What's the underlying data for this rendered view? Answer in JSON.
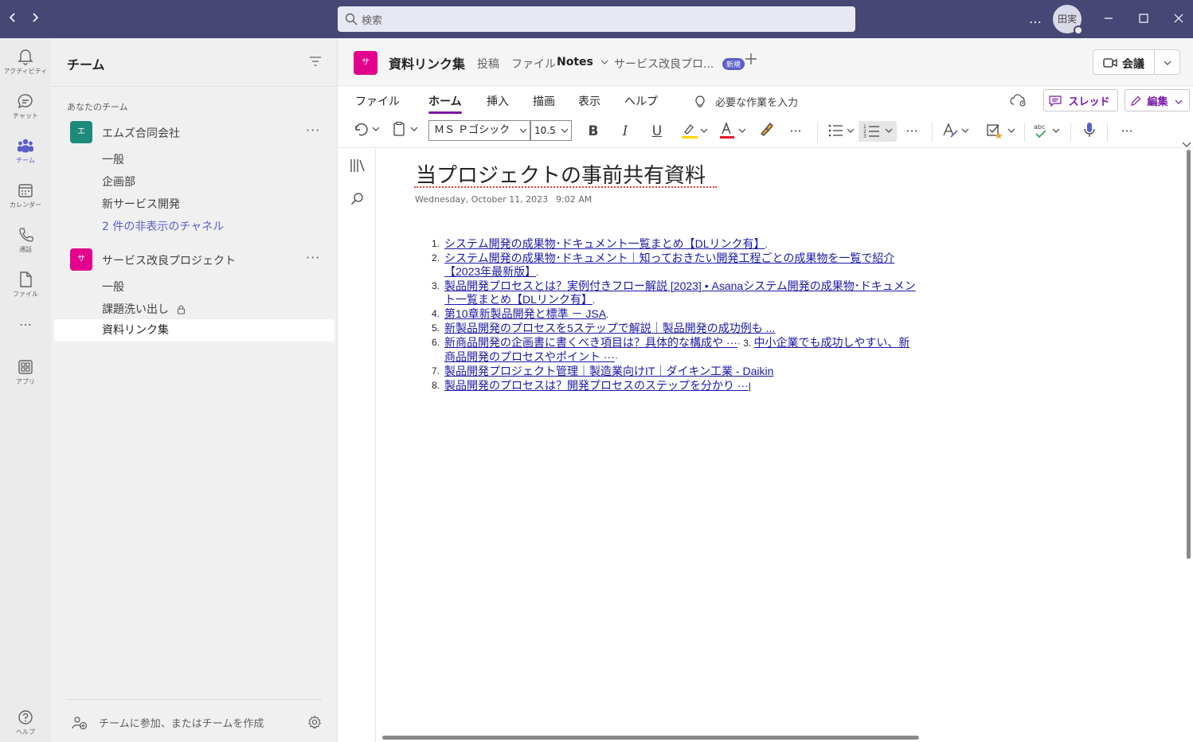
{
  "titlebar": {
    "search_placeholder": "検索",
    "avatar_initials": "田実",
    "more": "…"
  },
  "rail": [
    {
      "name": "activity",
      "label": "アクティビティ"
    },
    {
      "name": "chat",
      "label": "チャット"
    },
    {
      "name": "teams",
      "label": "チーム"
    },
    {
      "name": "calendar",
      "label": "カレンダー"
    },
    {
      "name": "calls",
      "label": "通話"
    },
    {
      "name": "files",
      "label": "ファイル"
    },
    {
      "name": "more",
      "label": "…"
    },
    {
      "name": "apps",
      "label": "アプリ"
    },
    {
      "name": "help",
      "label": "ヘルプ"
    }
  ],
  "teams_panel": {
    "title": "チーム",
    "section": "あなたのチーム",
    "teams": [
      {
        "icon_text": "エ",
        "color": "#1e8a7a",
        "name": "エムズ合同会社",
        "channels": [
          "一般",
          "企画部",
          "新サービス開発"
        ],
        "hidden_channels": "2 件の非表示のチャネル"
      },
      {
        "icon_text": "サ",
        "color": "#e3008c",
        "name": "サービス改良プロジェクト",
        "channels": [
          "一般",
          "課題洗い出し",
          "資料リンク集"
        ]
      }
    ],
    "join": "チームに参加、またはチームを作成"
  },
  "channel_header": {
    "icon_text": "サ",
    "name": "資料リンク集",
    "tabs": [
      "投稿",
      "ファイル",
      "Notes",
      "サービス改良プロ..."
    ],
    "new_badge": "新規",
    "meet_label": "会議"
  },
  "ribbon": {
    "tabs": [
      "ファイル",
      "ホーム",
      "挿入",
      "描画",
      "表示",
      "ヘルプ"
    ],
    "active_tab": "ホーム",
    "tell_me": "必要な作業を入力",
    "thread_button": "スレッド",
    "edit_button": "編集",
    "font_name": "ＭＳ Ｐゴシック",
    "font_size": "10.5",
    "accent_color": "#7719aa"
  },
  "page": {
    "title": "当プロジェクトの事前共有資料",
    "date": "Wednesday, October 11, 2023",
    "time": "9:02 AM",
    "items": [
      {
        "num": "1.",
        "text": "システム開発の成果物･ドキュメント一覧まとめ【DLリンク有】",
        "suffix": "."
      },
      {
        "num": "2.",
        "text": "システム開発の成果物･ドキュメント｜知っておきたい開発工程ごとの成果物を一覧で紹介【2023年最新版】",
        "suffix": "."
      },
      {
        "num": "3.",
        "text": "製品開発プロセスとは？実例付きフロー解説 [2023] • Asanaシステム開発の成果物･ドキュメント一覧まとめ【DLリンク有】",
        "suffix": "."
      },
      {
        "num": "4.",
        "text": "第10章新製品開発と標準 － JSA",
        "suffix": "."
      },
      {
        "num": "5.",
        "text": "新製品開発のプロセスを5ステップで解説｜製品開発の成功例も ...",
        "suffix": ""
      },
      {
        "num": "6.",
        "text": " 新商品開発の企画書に書くべき項目は？具体的な構成や ···",
        "suffix": "· 3.   ",
        "text2": "中小企業でも成功しやすい、新商品開発のプロセスやポイント ···",
        "suffix2": "·"
      },
      {
        "num": "7.",
        "text": "製品開発プロジェクト管理｜製造業向けIT｜ダイキン工業 - Daikin",
        "suffix": ""
      },
      {
        "num": "8.",
        "text": " 製品開発のプロセスは？開発プロセスのステップを分かり ···",
        "suffix": "|"
      }
    ]
  }
}
